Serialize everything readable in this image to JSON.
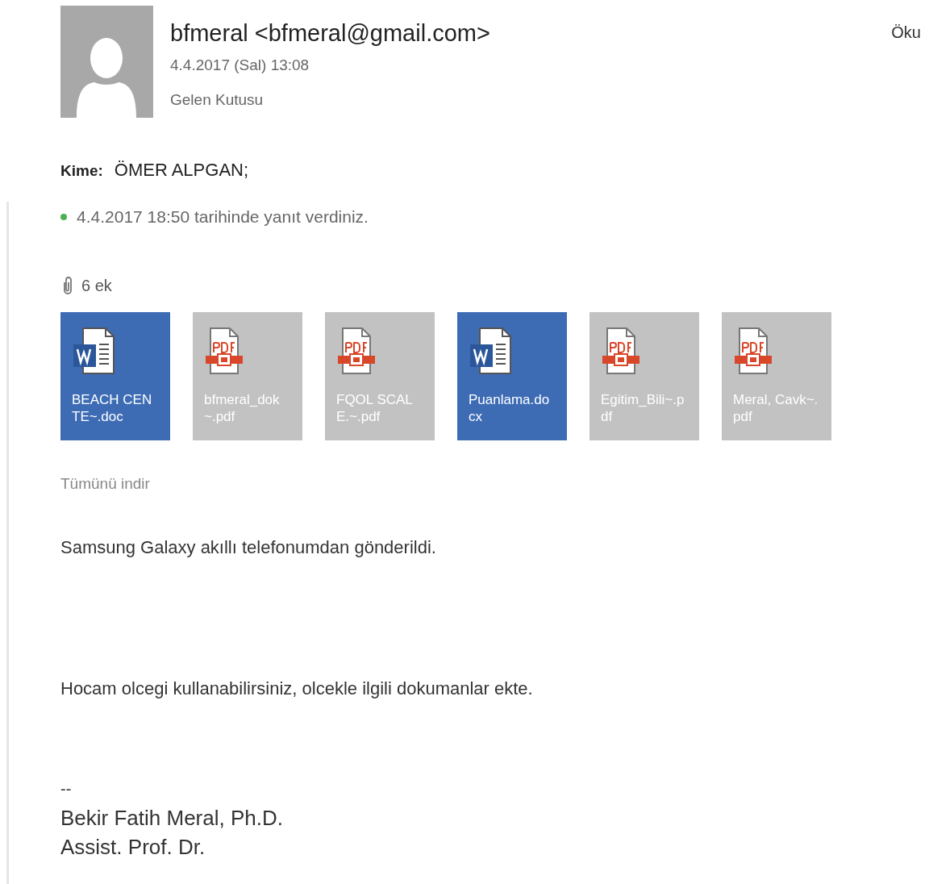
{
  "header": {
    "sender": "bfmeral <bfmeral@gmail.com>",
    "date": "4.4.2017 (Sal) 13:08",
    "folder": "Gelen Kutusu",
    "action": "Öku"
  },
  "recipients": {
    "label": "Kime:",
    "value": "ÖMER ALPGAN;"
  },
  "reply_status": {
    "text": "4.4.2017 18:50 tarihinde yanıt verdiniz.",
    "color": "#4caf50"
  },
  "attachments": {
    "count": "6 ek",
    "items": [
      {
        "kind": "word",
        "name": "BEACH CENTE~.doc"
      },
      {
        "kind": "pdf",
        "name": "bfmeral_dok~.pdf"
      },
      {
        "kind": "pdf",
        "name": "FQOL SCALE.~.pdf"
      },
      {
        "kind": "word",
        "name": "Puanlama.docx"
      },
      {
        "kind": "pdf",
        "name": "Egitim_Bili~.pdf"
      },
      {
        "kind": "pdf",
        "name": "Meral, Cavk~.pdf"
      }
    ],
    "download_all": "Tümünü indir"
  },
  "body": [
    "Samsung Galaxy akıllı telefonumdan gönderildi.",
    "Hocam olcegi kullanabilirsiniz, olcekle ilgili dokumanlar ekte."
  ],
  "signature": [
    "--",
    "Bekir Fatih Meral, Ph.D.",
    "Assist. Prof. Dr."
  ]
}
